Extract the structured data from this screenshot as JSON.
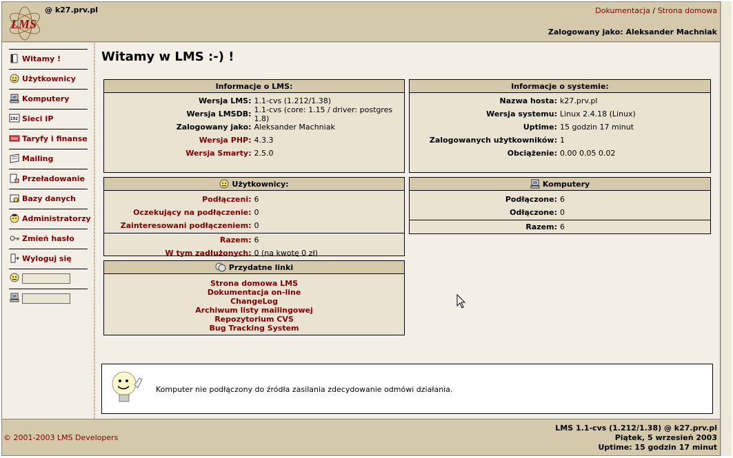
{
  "header": {
    "hostname": "@ k27.prv.pl",
    "link_docs": "Dokumentacja",
    "link_sep": "/",
    "link_home": "Strona domowa",
    "logged_as": "Zalogowany jako: Aleksander Machniak"
  },
  "sidebar": {
    "items": [
      {
        "label": "Witamy !",
        "icon": "book-icon"
      },
      {
        "label": "Użytkownicy",
        "icon": "user-icon"
      },
      {
        "label": "Komputery",
        "icon": "computer-icon"
      },
      {
        "label": "Sieci IP",
        "icon": "network-icon"
      },
      {
        "label": "Taryfy i finanse",
        "icon": "money-icon"
      },
      {
        "label": "Mailing",
        "icon": "mail-icon"
      },
      {
        "label": "Przeładowanie",
        "icon": "reload-icon"
      },
      {
        "label": "Bazy danych",
        "icon": "database-icon"
      },
      {
        "label": "Administratorzy",
        "icon": "admin-icon"
      },
      {
        "label": "Zmień hasło",
        "icon": "key-icon"
      },
      {
        "label": "Wyloguj się",
        "icon": "logout-icon"
      }
    ],
    "quick_user_value": "",
    "quick_computer_value": ""
  },
  "main": {
    "title": "Witamy w LMS :-) !",
    "lms_info": {
      "title": "Informacje o LMS:",
      "rows": [
        {
          "k": "Wersja LMS:",
          "v": "1.1-cvs (1.212/1.38)"
        },
        {
          "k": "Wersja LMSDB:",
          "v": "1.1-cvs (core: 1.15 / driver: postgres 1.8)"
        },
        {
          "k": "Zalogowany jako:",
          "v": "Aleksander Machniak"
        },
        {
          "k": "Wersja PHP:",
          "v": "4.3.3"
        },
        {
          "k": "Wersja Smarty:",
          "v": "2.5.0"
        }
      ]
    },
    "sys_info": {
      "title": "Informacje o systemie:",
      "rows": [
        {
          "k": "Nazwa hosta:",
          "v": "k27.prv.pl"
        },
        {
          "k": "Wersja systemu:",
          "v": "Linux 2.4.18 (Linux)"
        },
        {
          "k": "Uptime:",
          "v": "15 godzin 17 minut"
        },
        {
          "k": "Zalogowanych użytkowników:",
          "v": "1"
        },
        {
          "k": "Obciążenie:",
          "v": "0.00 0.05 0.02"
        }
      ]
    },
    "users": {
      "title": "Użytkownicy:",
      "rows": [
        {
          "k": "Podłączeni:",
          "v": "6"
        },
        {
          "k": "Oczekujący na podłączenie:",
          "v": "0"
        },
        {
          "k": "Zainteresowani podłączeniem:",
          "v": "0"
        },
        {
          "k": "Razem:",
          "v": "6"
        },
        {
          "k": "W tym zadłużonych:",
          "v": "0 (na kwotę 0 zł)"
        }
      ]
    },
    "computers": {
      "title": "Komputery",
      "rows": [
        {
          "k": "Podłączone:",
          "v": "6"
        },
        {
          "k": "Odłączone:",
          "v": "0"
        },
        {
          "k": "Razem:",
          "v": "6"
        }
      ]
    },
    "links": {
      "title": "Przydatne linki",
      "items": [
        "Strona domowa LMS",
        "Dokumentacja on-line",
        "ChangeLog",
        "Archiwum listy mailingowej",
        "Repozytorium CVS",
        "Bug Tracking System"
      ]
    },
    "tip": "Komputer nie podłączony do źródła zasilania zdecydowanie odmówi działania."
  },
  "footer": {
    "copyright": "© 2001-2003 LMS Developers",
    "version": "LMS 1.1-cvs (1.212/1.38) @ k27.prv.pl",
    "date": "Piątek, 5 wrzesień 2003",
    "uptime": "Uptime: 15 godzin 17 minut"
  }
}
